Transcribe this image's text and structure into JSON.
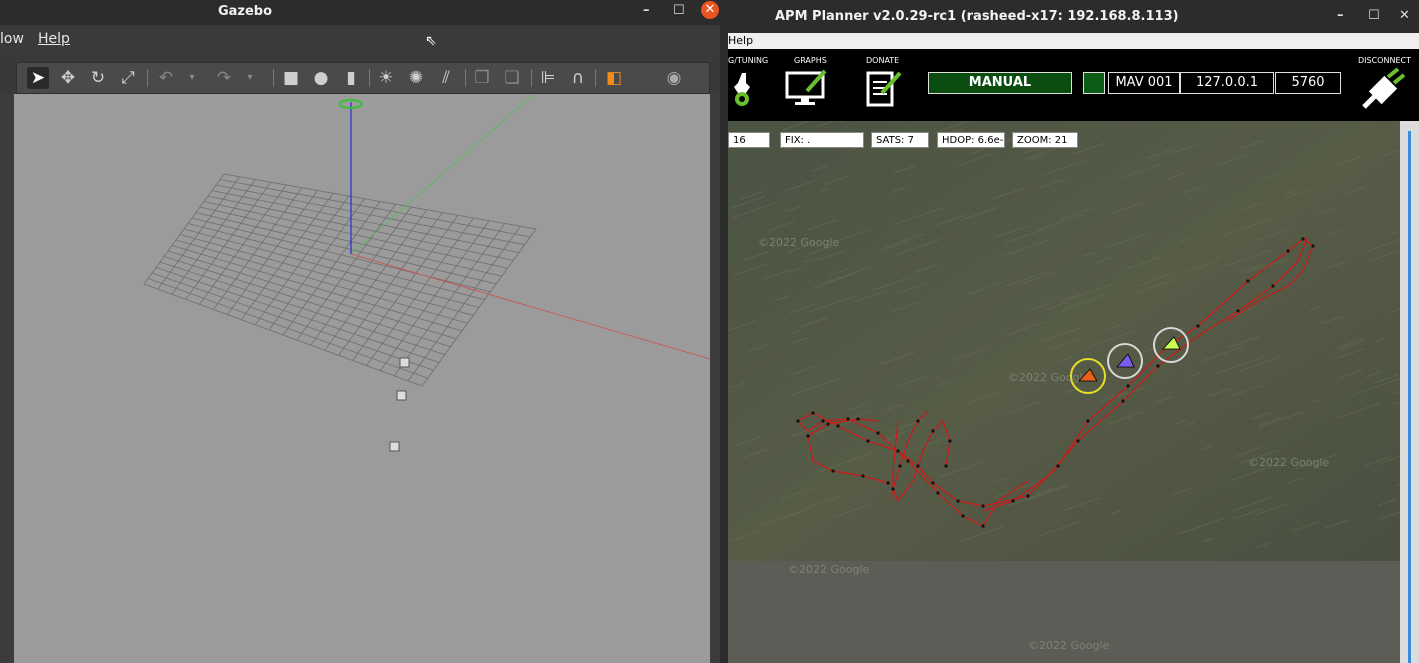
{
  "gazebo": {
    "title": "Gazebo",
    "controls": {
      "minimize": "–",
      "maximize": "☐",
      "close": "✕"
    },
    "menu": [
      {
        "label": "low"
      },
      {
        "label": "Help"
      }
    ],
    "toolbar_icons": [
      "select-arrow-icon",
      "translate-icon",
      "rotate-icon",
      "scale-icon",
      "undo-icon",
      "redo-icon",
      "box-shape-icon",
      "sphere-shape-icon",
      "cylinder-shape-icon",
      "point-light-icon",
      "spot-light-icon",
      "directional-light-icon",
      "copy-icon",
      "paste-icon",
      "align-icon",
      "magnet-icon",
      "view-angle-icon",
      "screenshot-icon"
    ],
    "colors": {
      "viewport": "#9b9b9b",
      "accent": "#e95420"
    }
  },
  "apm": {
    "title": "APM Planner v2.0.29-rc1 (rasheed-x17: 192.168.8.113)",
    "controls": {
      "minimize": "–",
      "maximize": "☐",
      "close": "✕"
    },
    "menu_help": "Help",
    "toolbar": {
      "tuning_label": "G/TUNING",
      "graphs_label": "GRAPHS",
      "donate_label": "DONATE",
      "disconnect_label": "DISCONNECT",
      "mode": "MANUAL",
      "mav": "MAV 001",
      "ip": "127.0.0.1",
      "port": "5760"
    },
    "status": {
      "s1": "16",
      "fix": "FIX: .",
      "sats": "SATS: 7",
      "hdop": "HDOP: 6.6e-",
      "zoom": "ZOOM: 21"
    },
    "map_watermarks": [
      "©2022 Google",
      "©2022 Google",
      "©2022 Google",
      "©2022 Google",
      "©2022 Google"
    ],
    "vehicle_colors": [
      "#e8601c",
      "#7a5cf0",
      "#c8ff50"
    ],
    "colors": {
      "mode_bg": "#0b4d11",
      "track": "#d01818"
    }
  }
}
